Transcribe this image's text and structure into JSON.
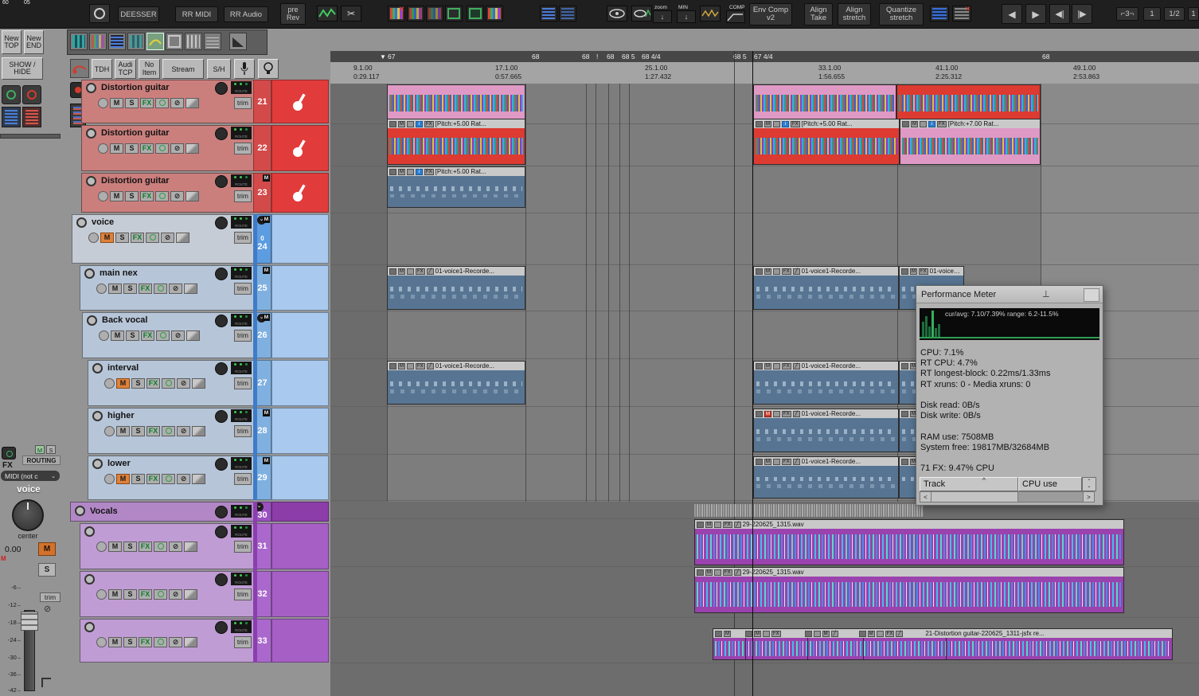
{
  "corner": {
    "frag1": "60",
    "frag2": "05"
  },
  "icons": {
    "env": "⊘",
    "scissors": "✂",
    "pencil": "✎",
    "prev": "◀",
    "play": "▶",
    "jump_back": "◀|",
    "jump_fwd": "|▶",
    "caret": "^",
    "left": "<",
    "right": ">",
    "chev": "⌄",
    "slash": "╱",
    "tri_down": "▼",
    "pin": "⊤",
    "spin_up": "⌃",
    "spin_dn": "⌄",
    "info": "i",
    "down": "↓",
    "up": "↑"
  },
  "toolbar": {
    "deesser": "DEESSER",
    "rr_midi": "RR MIDI",
    "rr_audio": "RR Audio",
    "pre_rev": "pre\nRev",
    "zoom": "zoom",
    "min": "MIN",
    "comp": "COMP",
    "env_comp": "Env Comp\nv2",
    "align_take": "Align\nTake",
    "align_stretch": "Align\nstretch",
    "quantize_stretch": "Quantize\nstretch",
    "retro": "⌐3¬",
    "grid_a": "1",
    "grid_b": "1/2",
    "grid_c": "1"
  },
  "rail": {
    "new_top": "New\nTOP",
    "new_end": "New\nEND",
    "show_hide": "SHOW /\nHIDE"
  },
  "options": {
    "tdh": "TDH",
    "audi_tcp": "Audi\nTCP",
    "no_item": "No\nItem",
    "stream": "Stream",
    "sh": "S/H"
  },
  "ruler": {
    "markers": [
      "67",
      "68",
      "68",
      "!",
      "68",
      "68 5",
      "68 4/4",
      "68 5",
      "67 4/4",
      "68"
    ],
    "times": [
      {
        "bar": "9.1.00",
        "time": "0:29.117"
      },
      {
        "bar": "17.1.00",
        "time": "0:57.665"
      },
      {
        "bar": "25.1.00",
        "time": "1:27.432"
      },
      {
        "bar": "33.1.00",
        "time": "1:56.655"
      },
      {
        "bar": "41.1.00",
        "time": "2:25.312"
      },
      {
        "bar": "49.1.00",
        "time": "2:53.863"
      }
    ]
  },
  "track_ui": {
    "m": "M",
    "s": "S",
    "fx": "FX",
    "trim": "trim",
    "route": "ROUTE"
  },
  "tracks": [
    {
      "num": "21",
      "name": "Distortion guitar"
    },
    {
      "num": "22",
      "name": "Distortion guitar"
    },
    {
      "num": "23",
      "name": "Distortion guitar"
    },
    {
      "num": "24",
      "name": "voice",
      "prefix": "0"
    },
    {
      "num": "25",
      "name": "main nex"
    },
    {
      "num": "26",
      "name": "Back vocal"
    },
    {
      "num": "27",
      "name": "interval"
    },
    {
      "num": "28",
      "name": "higher"
    },
    {
      "num": "29",
      "name": "lower"
    },
    {
      "num": "30",
      "name": "Vocals"
    },
    {
      "num": "31",
      "name": ""
    },
    {
      "num": "32",
      "name": ""
    },
    {
      "num": "33",
      "name": ""
    }
  ],
  "items": {
    "pitch5": "[Pitch:+5.00 Rat...",
    "pitch7": "[Pitch:+7.00 Rat...",
    "voice_rec": "01-voice1-Recorde...",
    "wav1315": "29-220625_1315.wav",
    "wav_dist": "21-Distortion guitar-220625_1311-jsfx re..."
  },
  "master": {
    "fx": "FX",
    "routing": "ROUTING",
    "mini_m": "M",
    "mini_s": "S",
    "midi": "MIDI (not c",
    "name": "voice",
    "pan_label": "center",
    "vol": "0.00",
    "m": "M",
    "s": "S",
    "trim": "trim",
    "db": [
      "-6",
      "-12",
      "-18",
      "-24",
      "-30",
      "-36",
      "-42"
    ]
  },
  "perf": {
    "title": "Performance Meter",
    "graph_line": "cur/avg: 7.10/7.39%   range: 6.2-11.5%",
    "stats": [
      "CPU: 7.1%",
      "RT CPU: 4.7%",
      "RT longest-block: 0.22ms/1.33ms",
      "RT xruns: 0 - Media xruns: 0",
      "",
      "Disk read: 0B/s",
      "Disk write: 0B/s",
      "",
      "RAM use: 7508MB",
      "System free: 19817MB/32684MB",
      "",
      "71 FX: 9.47% CPU"
    ],
    "col_track": "Track",
    "col_cpu": "CPU use"
  }
}
